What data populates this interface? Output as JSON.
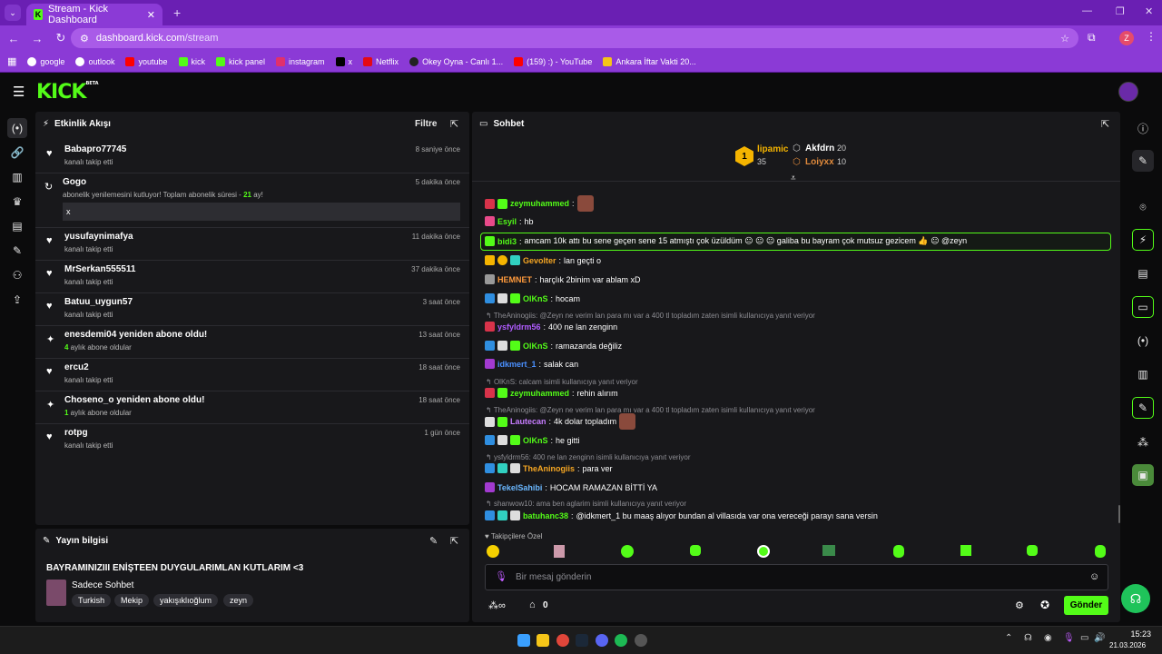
{
  "browser": {
    "tab_title": "Stream - Kick Dashboard",
    "url_host": "dashboard.kick.com",
    "url_path": "/stream",
    "profile_initial": "Z",
    "bookmarks": [
      "google",
      "outlook",
      "youtube",
      "kick",
      "kick panel",
      "instagram",
      "x",
      "Netflix",
      "Okey Oyna - Canlı 1...",
      "(159) :) - YouTube",
      "Ankara İftar Vakti 20..."
    ]
  },
  "logo": {
    "text": "KICK",
    "badge": "BETA"
  },
  "activity": {
    "title": "Etkinlik Akışı",
    "filter_label": "Filtre",
    "events": [
      {
        "name": "Babapro77745",
        "sub": "kanalı takip etti",
        "time": "8 saniye önce",
        "icon": "heart-icon"
      },
      {
        "name": "Gogo",
        "sub": "abonelik yenilemesini kutluyor! Toplam abonelik süresi - ",
        "months": "21",
        "sub_end": " ay!",
        "message": "x",
        "time": "5 dakika önce",
        "icon": "renew-icon"
      },
      {
        "name": "yusufaynimafya",
        "sub": "kanalı takip etti",
        "time": "11 dakika önce",
        "icon": "heart-icon"
      },
      {
        "name": "MrSerkan555511",
        "sub": "kanalı takip etti",
        "time": "37 dakika önce",
        "icon": "heart-icon"
      },
      {
        "name": "Batuu_uygun57",
        "sub": "kanalı takip etti",
        "time": "3 saat önce",
        "icon": "heart-icon"
      },
      {
        "name": "enesdemi04 yeniden abone oldu!",
        "months": "4",
        "sub": " aylık abone oldular",
        "time": "13 saat önce",
        "icon": "sparkle-icon"
      },
      {
        "name": "ercu2",
        "sub": "kanalı takip etti",
        "time": "18 saat önce",
        "icon": "heart-icon"
      },
      {
        "name": "Choseno_o yeniden abone oldu!",
        "months": "1",
        "sub": " aylık abone oldular",
        "time": "18 saat önce",
        "icon": "sparkle-icon"
      },
      {
        "name": "rotpg",
        "sub": "kanalı takip etti",
        "time": "1 gün önce",
        "icon": "heart-icon"
      }
    ]
  },
  "stream_info": {
    "title": "Yayın bilgisi",
    "stream_title": "BAYRAMINIZIII ENİŞTEEN DUYGULARIMLAN KUTLARIM <3",
    "category": "Sadece Sohbet",
    "tags": [
      "Turkish",
      "Mekip",
      "yakışıklıoğlum",
      "zeyn"
    ]
  },
  "chat": {
    "title": "Sohbet",
    "leaderboard": {
      "first": {
        "rank": "1",
        "name": "lipamic",
        "count": "35"
      },
      "second": {
        "name": "Akfdrn",
        "count": "20"
      },
      "third": {
        "name": "Loiyxx",
        "count": "10"
      }
    },
    "messages": [
      {
        "user": "zeymuhammed",
        "text": "",
        "color": "#53fc18"
      },
      {
        "user": "Esyil",
        "text": "hb",
        "color": "#53fc18"
      },
      {
        "user": "bidi3",
        "text": "amcam 10k attı bu sene geçen sene 15 atmıştı çok üzüldüm 😐 😐 😐 galiba bu bayram çok mutsuz gezicem 👍 😐 @zeyn",
        "color": "#53fc18"
      },
      {
        "user": "Gevolter",
        "text": "lan geçti o",
        "color": "#f5a623"
      },
      {
        "user": "HEMNET",
        "text": "harçlık 2binim var ablam xD",
        "color": "#ff9a3c"
      },
      {
        "user": "OlKnS",
        "text": "hocam",
        "color": "#53fc18"
      },
      {
        "reply": "TheAninogiis: @Zeyn ne verim lan para mı var a 400 tl topladım zaten isimli kullanıcıya yanıt veriyor",
        "user": "ysfyldrm56",
        "text": "400 ne lan zenginn",
        "color": "#b05cff"
      },
      {
        "user": "OlKnS",
        "text": "ramazanda değiliz",
        "color": "#53fc18"
      },
      {
        "user": "idkmert_1",
        "text": "salak can",
        "color": "#4a90ff"
      },
      {
        "reply": "OlKnS: calcam isimli kullanıcıya yanıt veriyor",
        "user": "zeymuhammed",
        "text": "rehin alırım",
        "color": "#53fc18"
      },
      {
        "reply": "TheAninogiis: @Zeyn ne verim lan para mı var a 400 tl topladım zaten isimli kullanıcıya yanıt veriyor",
        "user": "Lautecan",
        "text": "4k dolar topladım",
        "color": "#c77dff"
      },
      {
        "user": "OlKnS",
        "text": "he gitti",
        "color": "#53fc18"
      },
      {
        "reply": "ysfyldrm56: 400 ne lan zenginn isimli kullanıcıya yanıt veriyor",
        "user": "TheAninogiis",
        "text": "para ver",
        "color": "#f5a623"
      },
      {
        "user": "TekelSahibi",
        "text": "HOCAM RAMAZAN BİTTİ YA",
        "color": "#6ab7ff"
      },
      {
        "reply": "shanwow10: ama ben aglarim isimli kullanıcıya yanıt veriyor",
        "user": "batuhanc38",
        "text": "@idkmert_1 bu maaş alıyor bundan al villasıda var ona vereceği parayı sana versin",
        "color": "#53fc18"
      }
    ],
    "emote_section": "Takipçilere Özel",
    "input_placeholder": "Bir mesaj gönderin",
    "points": "0",
    "send_label": "Gönder"
  },
  "taskbar": {
    "time": "15:23",
    "date": "21.03.2026"
  }
}
